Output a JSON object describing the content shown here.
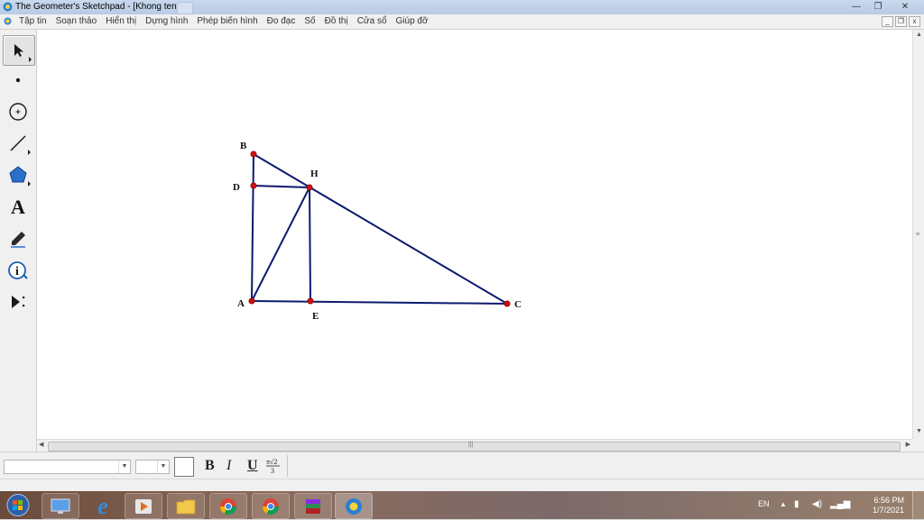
{
  "window": {
    "title": "The Geometer's Sketchpad - [Khong ten 1]",
    "controls": {
      "minimize": "—",
      "maximize": "❐",
      "close": "✕"
    }
  },
  "menu": {
    "items": [
      "Tập tin",
      "Soạn thảo",
      "Hiển thị",
      "Dựng hình",
      "Phép biến hình",
      "Đo đạc",
      "Số",
      "Đồ thị",
      "Cửa sổ",
      "Giúp đỡ"
    ],
    "doc_controls": {
      "minimize": "_",
      "restore": "❐",
      "close": "x"
    }
  },
  "toolbox": {
    "tools": [
      {
        "name": "arrow-tool",
        "icon": "arrow-icon",
        "selected": true
      },
      {
        "name": "point-tool",
        "icon": "point-icon"
      },
      {
        "name": "compass-tool",
        "icon": "circle-icon"
      },
      {
        "name": "straightedge-tool",
        "icon": "segment-icon"
      },
      {
        "name": "polygon-tool",
        "icon": "pentagon-icon"
      },
      {
        "name": "text-tool",
        "icon": "text-icon",
        "glyph": "A"
      },
      {
        "name": "marker-tool",
        "icon": "marker-icon"
      },
      {
        "name": "information-tool",
        "icon": "info-icon",
        "glyph": "i"
      },
      {
        "name": "custom-tool",
        "icon": "custom-tool-icon"
      }
    ]
  },
  "sketch": {
    "line_color": "#0d1a6e",
    "point_color": "#d01010",
    "points": [
      {
        "label": "B"
      },
      {
        "label": "D"
      },
      {
        "label": "H"
      },
      {
        "label": "A"
      },
      {
        "label": "E"
      },
      {
        "label": "C"
      }
    ],
    "segments": [
      "AB",
      "BC",
      "CA",
      "AH",
      "HE",
      "DH"
    ]
  },
  "format_bar": {
    "font_value": "",
    "size_value": "",
    "bold": "B",
    "italic": "I",
    "underline": "U",
    "math_format": "π√2 / 3"
  },
  "taskbar": {
    "apps": [
      "start-orb",
      "sketchpad-task",
      "internet-explorer",
      "media-player",
      "file-explorer",
      "chrome-beta",
      "chrome",
      "winrar",
      "sketchpad-running"
    ],
    "language": "EN",
    "time": "6:56 PM",
    "date": "1/7/2021"
  }
}
